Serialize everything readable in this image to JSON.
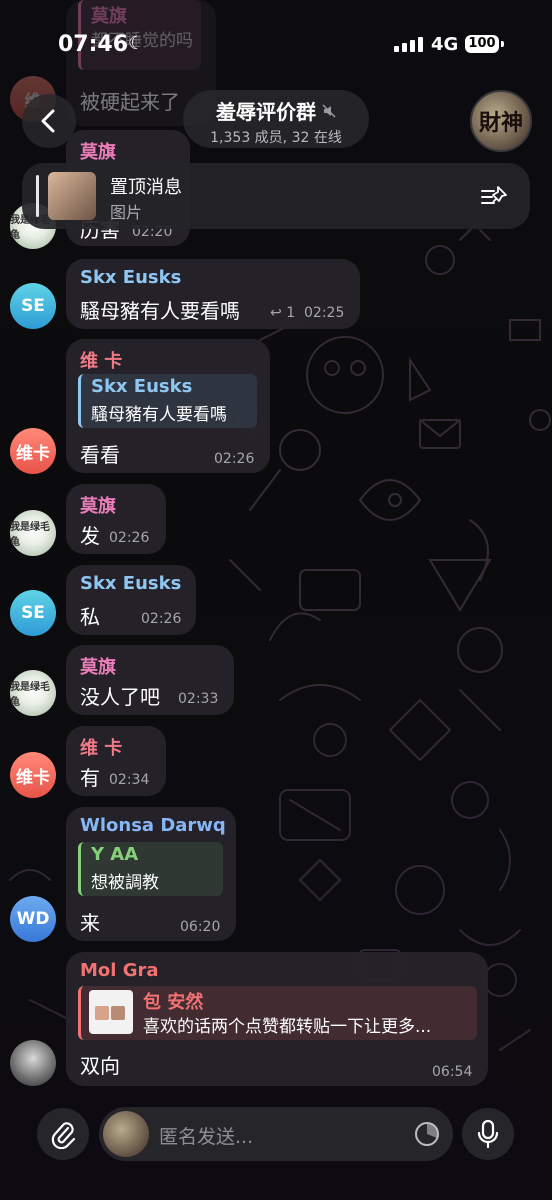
{
  "status": {
    "time": "07:46",
    "network": "4G",
    "battery": "100"
  },
  "header": {
    "title": "羞辱评价群",
    "subtitle": "1,353 成员, 32 在线"
  },
  "group_avatar_text": "財神",
  "pinned": {
    "title": "置顶消息",
    "subtitle": "图片"
  },
  "top_partial": {
    "name1": "莫旗",
    "line1": "都不睡觉的吗",
    "line2": "被硬起来了",
    "name2": "莫旗",
    "text2": "历害",
    "time2": "02:20",
    "avatar_label": "维"
  },
  "avatar_texts": {
    "se": "SE",
    "wk": "维卡",
    "wd": "WD",
    "img": "我是绿毛龟"
  },
  "messages": [
    {
      "sender": "Skx Eusks",
      "text": "騷母豬有人要看嗎",
      "reply_count": "1",
      "time": "02:25"
    },
    {
      "sender": "维 卡",
      "reply_name": "Skx Eusks",
      "reply_text": "騷母豬有人要看嗎",
      "text": "看看",
      "time": "02:26"
    },
    {
      "sender": "莫旗",
      "text": "发",
      "time": "02:26"
    },
    {
      "sender": "Skx Eusks",
      "text": "私",
      "time": "02:26"
    },
    {
      "sender": "莫旗",
      "text": "没人了吧",
      "time": "02:33"
    },
    {
      "sender": "维 卡",
      "text": "有",
      "time": "02:34"
    },
    {
      "sender": "Wlonsa Darwq",
      "reply_name": "Y AA",
      "reply_text": "想被調教",
      "text": "来",
      "time": "06:20"
    },
    {
      "sender": "Mol Gra",
      "reply_name": "包 安然",
      "reply_text": "喜欢的话两个点赞都转贴一下让更多...",
      "text": "双向",
      "time": "06:54"
    }
  ],
  "composer": {
    "placeholder": "匿名发送..."
  },
  "colors": {
    "skx": "#8fc7f2",
    "weika": "#f27a86",
    "moqi": "#e87db7",
    "wlonsa": "#86b6f5",
    "molgra": "#f27272",
    "reply_green": "#86d07a"
  }
}
